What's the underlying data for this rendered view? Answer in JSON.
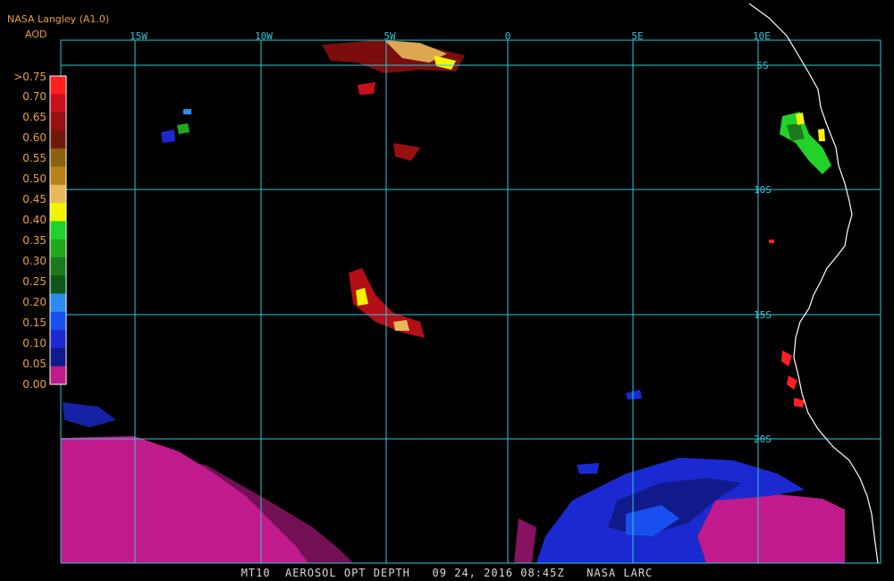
{
  "header": {
    "source": "NASA Langley (A1.0)",
    "product": "AOD"
  },
  "legend": {
    "labels": [
      ">0.75",
      "0.70",
      "0.65",
      "0.60",
      "0.55",
      "0.50",
      "0.45",
      "0.40",
      "0.35",
      "0.30",
      "0.25",
      "0.20",
      "0.15",
      "0.10",
      "0.05",
      "0.00"
    ],
    "colors": [
      "#ff2020",
      "#c8101c",
      "#9a1010",
      "#6e1a08",
      "#8a6210",
      "#b88318",
      "#e8b85a",
      "#f4f400",
      "#22d22a",
      "#20a81e",
      "#1c7a1c",
      "#10561a",
      "#2a8cf0",
      "#1850f0",
      "#1a2ad0",
      "#101a8a",
      "#c01a8c"
    ]
  },
  "grid": {
    "lon_labels": [
      "15W",
      "10W",
      "5W",
      "0",
      "5E",
      "10E"
    ],
    "lat_labels": [
      "5S",
      "10S",
      "15S",
      "20S"
    ]
  },
  "footer": {
    "text": "MT10  AEROSOL OPT DEPTH   09 24, 2016 08:45Z   NASA LARC"
  },
  "colors": {
    "grid": "#2ec8d8",
    "coast": "#ffffff",
    "label": "#e8a23a",
    "no_aerosol": "#c01a8c"
  }
}
